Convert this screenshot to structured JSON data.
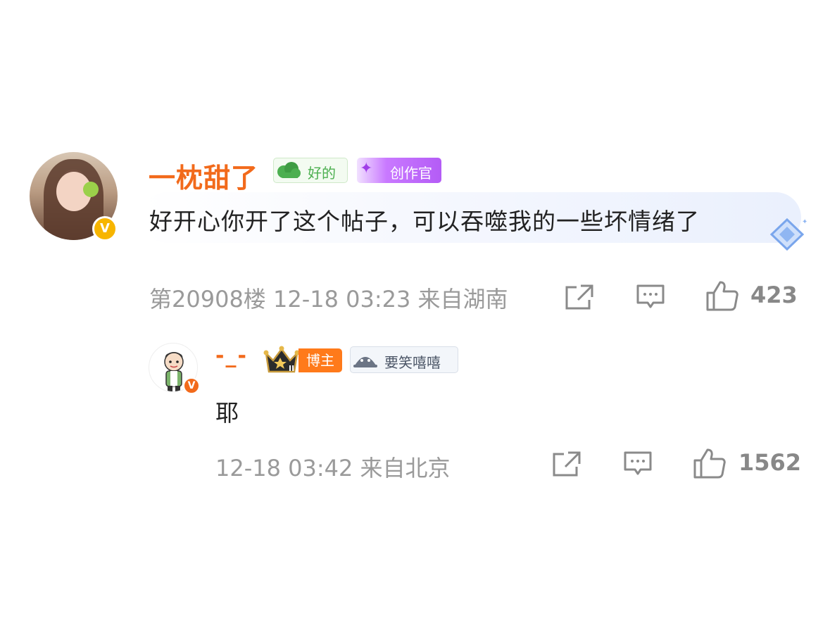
{
  "comment": {
    "username": "一枕甜了",
    "badge_good": "好的",
    "badge_creator": "创作官",
    "text": "好开心你开了这个帖子，可以吞噬我的一些坏情绪了",
    "meta": "第20908楼 12-18 03:23 来自湖南",
    "like_count": "423",
    "verified_mark": "V"
  },
  "reply": {
    "username": "-_-",
    "badge_host": "博主",
    "badge_smile": "要笑嘻嘻",
    "text": "耶",
    "meta": "12-18 03:42 来自北京",
    "like_count": "1562",
    "verified_mark": "V",
    "crown_level": "II"
  },
  "colors": {
    "username": "#f26a1b",
    "meta_gray": "#9a9a9a",
    "good_green": "#4caf50",
    "creator_purple": "#b45cf6",
    "host_orange": "#ff7a1a"
  },
  "icons": [
    "share-icon",
    "comment-icon",
    "like-icon",
    "diamond-decoration-icon",
    "crown-icon",
    "cloud-icon",
    "smile-badge-icon"
  ]
}
